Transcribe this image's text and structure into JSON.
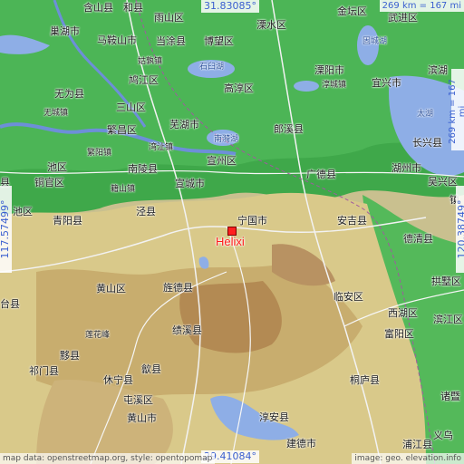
{
  "map": {
    "marker_label": "Helixi",
    "coords": {
      "top": "31.83085°",
      "bottom": "29.41084°",
      "left": "117.57499°",
      "right": "120.38749°"
    },
    "scale_horizontal": "269 km = 167 mi",
    "scale_vertical": "269 km = 167 mi",
    "attribution_left": "map data: openstreetmap.org, style: opentopomap",
    "attribution_right": "image: geo. elevation.info"
  },
  "places": [
    {
      "label": "含山县",
      "small": false
    },
    {
      "label": "和县",
      "small": false
    },
    {
      "label": "雨山区",
      "small": false
    },
    {
      "label": "溧水区",
      "small": false
    },
    {
      "label": "金坛区",
      "small": false
    },
    {
      "label": "武进区",
      "small": false
    },
    {
      "label": "巢湖市",
      "small": false
    },
    {
      "label": "马鞍山市",
      "small": false
    },
    {
      "label": "当涂县",
      "small": false
    },
    {
      "label": "博望区",
      "small": false
    },
    {
      "label": "姑孰镇",
      "small": true
    },
    {
      "label": "溧阳市",
      "small": false
    },
    {
      "label": "滨湖",
      "small": false
    },
    {
      "label": "无为县",
      "small": false
    },
    {
      "label": "鸠江区",
      "small": false
    },
    {
      "label": "高淳区",
      "small": false
    },
    {
      "label": "宜兴市",
      "small": false
    },
    {
      "label": "无城镇",
      "small": true
    },
    {
      "label": "淳城镇",
      "small": true
    },
    {
      "label": "三山区",
      "small": false
    },
    {
      "label": "芜湖市",
      "small": false
    },
    {
      "label": "繁昌区",
      "small": false
    },
    {
      "label": "郎溪县",
      "small": false
    },
    {
      "label": "长兴县",
      "small": false
    },
    {
      "label": "繁阳镇",
      "small": true
    },
    {
      "label": "湾沚镇",
      "small": true
    },
    {
      "label": "池区",
      "small": false
    },
    {
      "label": "铜官区",
      "small": false
    },
    {
      "label": "南陵县",
      "small": false
    },
    {
      "label": "宣州区",
      "small": false
    },
    {
      "label": "广德县",
      "small": false
    },
    {
      "label": "湖州市",
      "small": false
    },
    {
      "label": "籍山镇",
      "small": true
    },
    {
      "label": "宣城市",
      "small": false
    },
    {
      "label": "吴兴区",
      "small": false
    },
    {
      "label": "池区",
      "small": false
    },
    {
      "label": "泾县",
      "small": false
    },
    {
      "label": "宁国市",
      "small": false
    },
    {
      "label": "安吉县",
      "small": false
    },
    {
      "label": "青阳县",
      "small": false
    },
    {
      "label": "德清县",
      "small": false
    },
    {
      "label": "黄山区",
      "small": false
    },
    {
      "label": "旌德县",
      "small": false
    },
    {
      "label": "临安区",
      "small": false
    },
    {
      "label": "拱墅区",
      "small": false
    },
    {
      "label": "台县",
      "small": false
    },
    {
      "label": "西湖区",
      "small": false
    },
    {
      "label": "滨江区",
      "small": false
    },
    {
      "label": "莲花峰",
      "small": true
    },
    {
      "label": "绩溪县",
      "small": false
    },
    {
      "label": "富阳区",
      "small": false
    },
    {
      "label": "黟县",
      "small": false
    },
    {
      "label": "歙县",
      "small": false
    },
    {
      "label": "祁门县",
      "small": false
    },
    {
      "label": "休宁县",
      "small": false
    },
    {
      "label": "桐庐县",
      "small": false
    },
    {
      "label": "屯溪区",
      "small": false
    },
    {
      "label": "诸暨",
      "small": false
    },
    {
      "label": "黄山市",
      "small": false
    },
    {
      "label": "淳安县",
      "small": false
    },
    {
      "label": "建德市",
      "small": false
    },
    {
      "label": "浦江县",
      "small": false
    },
    {
      "label": "义乌",
      "small": false
    },
    {
      "label": "石臼湖",
      "small": true
    },
    {
      "label": "固城湖",
      "small": true
    },
    {
      "label": "南漪湖",
      "small": true
    },
    {
      "label": "太湖",
      "small": true
    },
    {
      "label": "县",
      "small": false
    },
    {
      "label": "镇",
      "small": false
    }
  ]
}
